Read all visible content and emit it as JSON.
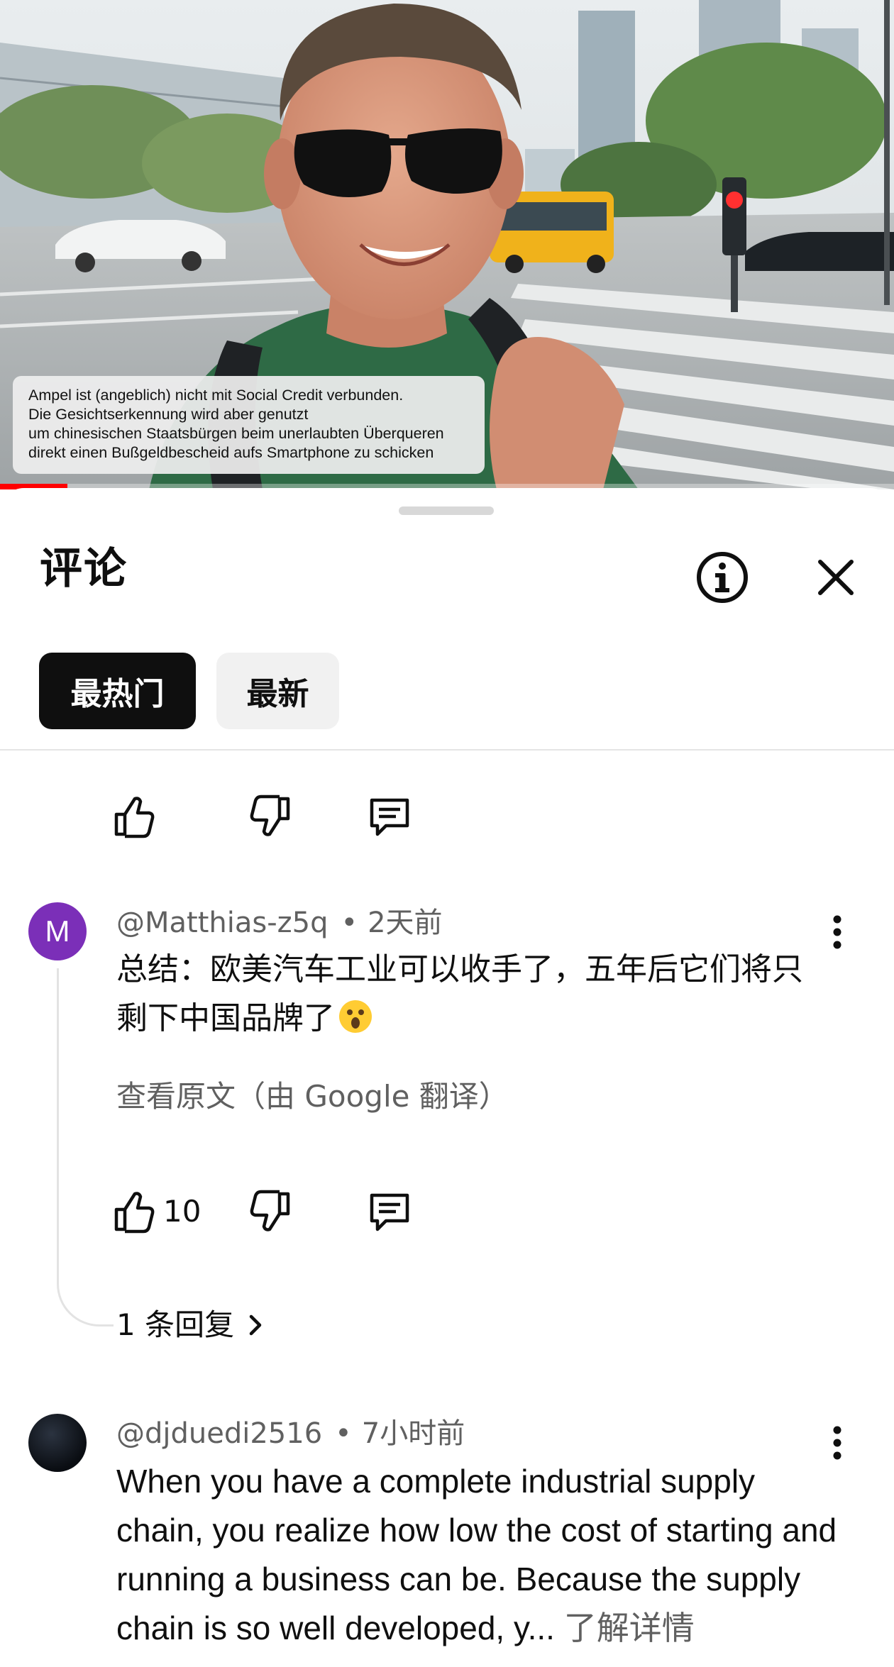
{
  "video": {
    "subtitle_lines": [
      "Ampel ist (angeblich) nicht mit Social Credit verbunden.",
      "Die Gesichtserkennung wird aber genutzt",
      "um chinesischen Staatsbürgen beim unerlaubten Überqueren",
      "direkt einen Bußgeldbescheid aufs Smartphone zu schicken"
    ],
    "progress_fraction": 0.075,
    "progress_color": "#ff0000"
  },
  "sheet": {
    "title": "评论",
    "info_icon": "info-icon",
    "close_icon": "close-icon"
  },
  "sort_chips": [
    {
      "label": "最热门",
      "selected": true
    },
    {
      "label": "最新",
      "selected": false
    }
  ],
  "top_actions": {
    "like_icon": "thumbs-up-icon",
    "dislike_icon": "thumbs-down-icon",
    "reply_icon": "comment-icon"
  },
  "comments": [
    {
      "avatar_letter": "M",
      "avatar_color": "#7b2fb8",
      "author": "@Matthias-z5q",
      "time": "2天前",
      "text": "总结：欧美汽车工业可以收手了，五年后它们将只剩下中国品牌了",
      "emoji": "astonished-face-emoji",
      "translate_label": "查看原文（由 Google 翻译）",
      "likes": "10",
      "replies_label": "1 条回复"
    },
    {
      "author": "@djduedi2516",
      "time": "7小时前",
      "text": "When you have a complete industrial supply chain, you realize how low the cost of starting and running a business can be. Because the supply chain is so well developed, y...",
      "more_label": "了解详情"
    }
  ]
}
